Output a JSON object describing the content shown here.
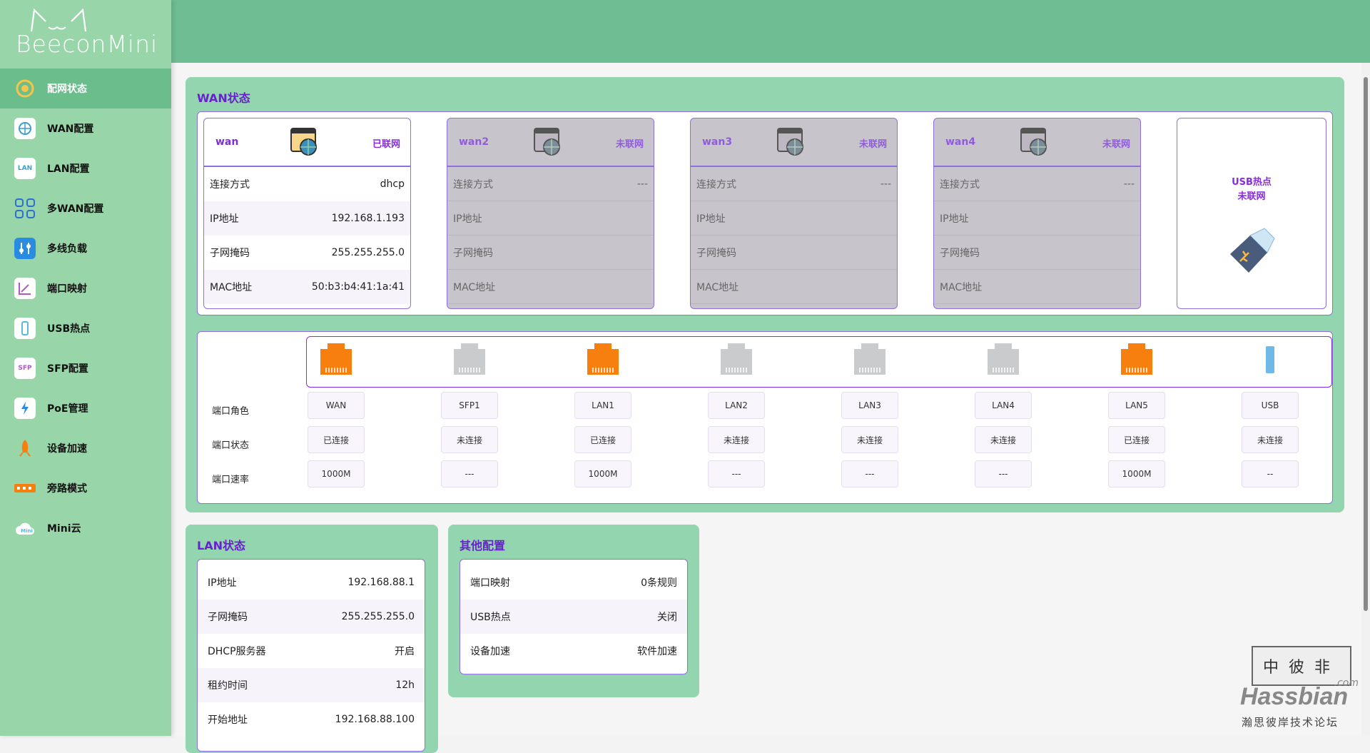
{
  "brand": {
    "name": "BeeconMini"
  },
  "sidebar": {
    "items": [
      {
        "label": "配网状态",
        "icon": "network-status-icon",
        "active": true
      },
      {
        "label": "WAN配置",
        "icon": "wan-config-icon"
      },
      {
        "label": "LAN配置",
        "icon": "lan-config-icon"
      },
      {
        "label": "多WAN配置",
        "icon": "multi-wan-icon"
      },
      {
        "label": "多线负载",
        "icon": "load-balance-icon"
      },
      {
        "label": "端口映射",
        "icon": "port-mapping-icon"
      },
      {
        "label": "USB热点",
        "icon": "usb-hotspot-icon"
      },
      {
        "label": "SFP配置",
        "icon": "sfp-icon"
      },
      {
        "label": "PoE管理",
        "icon": "poe-icon"
      },
      {
        "label": "设备加速",
        "icon": "rocket-icon"
      },
      {
        "label": "旁路模式",
        "icon": "bypass-icon"
      },
      {
        "label": "Mini云",
        "icon": "cloud-icon"
      }
    ]
  },
  "wan_status": {
    "title": "WAN状态",
    "row_labels": {
      "conn": "连接方式",
      "ip": "IP地址",
      "mask": "子网掩码",
      "mac": "MAC地址"
    },
    "cards": [
      {
        "name": "wan",
        "status": "已联网",
        "conn": "dhcp",
        "ip": "192.168.1.193",
        "mask": "255.255.255.0",
        "mac": "50:b3:b4:41:1a:41",
        "online": true
      },
      {
        "name": "wan2",
        "status": "未联网",
        "conn": "---",
        "ip": "",
        "mask": "",
        "mac": "",
        "online": false
      },
      {
        "name": "wan3",
        "status": "未联网",
        "conn": "---",
        "ip": "",
        "mask": "",
        "mac": "",
        "online": false
      },
      {
        "name": "wan4",
        "status": "未联网",
        "conn": "---",
        "ip": "",
        "mask": "",
        "mac": "",
        "online": false
      }
    ],
    "usb": {
      "title": "USB热点",
      "status": "未联网"
    }
  },
  "ports": {
    "labels": {
      "role": "端口角色",
      "state": "端口状态",
      "rate": "端口速率"
    },
    "items": [
      {
        "role": "WAN",
        "state": "已连接",
        "rate": "1000M",
        "active": true
      },
      {
        "role": "SFP1",
        "state": "未连接",
        "rate": "---",
        "active": false
      },
      {
        "role": "LAN1",
        "state": "已连接",
        "rate": "1000M",
        "active": true
      },
      {
        "role": "LAN2",
        "state": "未连接",
        "rate": "---",
        "active": false
      },
      {
        "role": "LAN3",
        "state": "未连接",
        "rate": "---",
        "active": false
      },
      {
        "role": "LAN4",
        "state": "未连接",
        "rate": "---",
        "active": false
      },
      {
        "role": "LAN5",
        "state": "已连接",
        "rate": "1000M",
        "active": true
      },
      {
        "role": "USB",
        "state": "未连接",
        "rate": "--",
        "active": false
      }
    ],
    "colors": {
      "active": "#f77f0d",
      "inactive": "#c9cbcd"
    }
  },
  "lan_status": {
    "title": "LAN状态",
    "rows": [
      {
        "label": "IP地址",
        "value": "192.168.88.1"
      },
      {
        "label": "子网掩码",
        "value": "255.255.255.0"
      },
      {
        "label": "DHCP服务器",
        "value": "开启"
      },
      {
        "label": "租约时间",
        "value": "12h"
      },
      {
        "label": "开始地址",
        "value": "192.168.88.100"
      }
    ]
  },
  "other_config": {
    "title": "其他配置",
    "rows": [
      {
        "label": "端口映射",
        "value": "0条规则"
      },
      {
        "label": "USB热点",
        "value": "关闭"
      },
      {
        "label": "设备加速",
        "value": "软件加速"
      }
    ]
  },
  "watermark": {
    "seal": "中彼非",
    "name": "Hassbian",
    "suffix": ".com",
    "caption": "瀚思彼岸技术论坛"
  }
}
